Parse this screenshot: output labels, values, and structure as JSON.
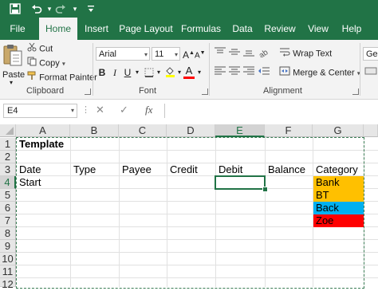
{
  "ribbon_tabs": [
    "File",
    "Home",
    "Insert",
    "Page Layout",
    "Formulas",
    "Data",
    "Review",
    "View",
    "Help"
  ],
  "clipboard": {
    "paste": "Paste",
    "cut": "Cut",
    "copy": "Copy",
    "format_painter": "Format Painter",
    "label": "Clipboard"
  },
  "font": {
    "name": "Arial",
    "size": "11",
    "grow": "A",
    "shrink": "A",
    "bold": "B",
    "italic": "I",
    "underline": "U",
    "font_color_glyph": "A",
    "label": "Font",
    "font_color": "#ff0000",
    "fill_color": "#ffff00"
  },
  "alignment": {
    "wrap_text": "Wrap Text",
    "merge_center": "Merge & Center",
    "label": "Alignment"
  },
  "number": {
    "format": "Gen"
  },
  "formula_bar": {
    "name_box": "E4",
    "cancel": "✕",
    "enter": "✓",
    "fx": "fx",
    "content": ""
  },
  "columns": [
    "A",
    "B",
    "C",
    "D",
    "E",
    "F",
    "G"
  ],
  "rows": [
    "1",
    "2",
    "3",
    "4",
    "5",
    "6",
    "7",
    "8",
    "9",
    "10",
    "11",
    "12"
  ],
  "cells": {
    "A1": "Template",
    "A3": "Date",
    "B3": "Type",
    "C3": "Payee",
    "D3": "Credit",
    "E3": "Debit",
    "F3": "Balance",
    "G3": "Category",
    "A4": "Start",
    "G4": "Bank",
    "G5": "BT",
    "G6": "Back",
    "G7": "Zoe"
  },
  "category_colors": {
    "Bank": "#ffc000",
    "BT": "#ffc000",
    "Back": "#00b0f0",
    "Zoe": "#ff0000"
  },
  "active_cell": "E4",
  "accent": "#217346"
}
